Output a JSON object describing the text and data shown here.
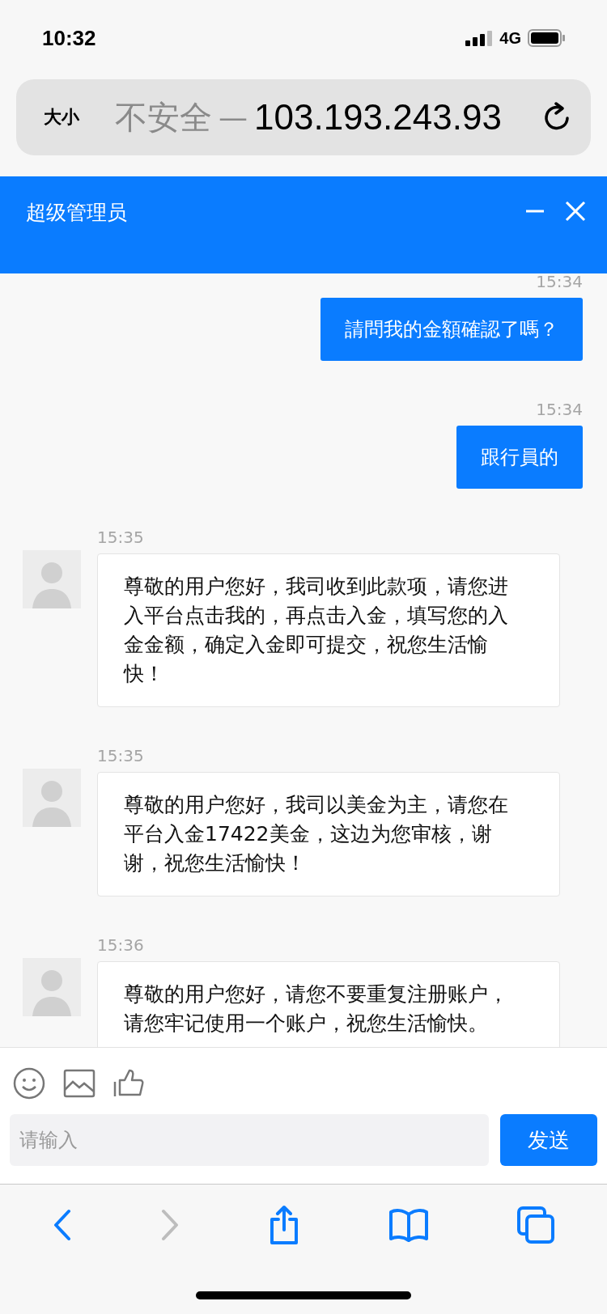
{
  "status_bar": {
    "time": "10:32",
    "network": "4G"
  },
  "address_bar": {
    "text_size": "大小",
    "security": "不安全",
    "separator": "—",
    "url": "103.193.243.93"
  },
  "chat_header": {
    "title": "超级管理员"
  },
  "messages": [
    {
      "kind": "sent",
      "time": "15:34",
      "text": "請問我的金額確認了嗎？"
    },
    {
      "kind": "sent",
      "time": "15:34",
      "text": "跟行員的"
    },
    {
      "kind": "received",
      "time": "15:35",
      "text": "尊敬的用户您好，我司收到此款项，请您进入平台点击我的，再点击入金，填写您的入金金额，确定入金即可提交，祝您生活愉快！"
    },
    {
      "kind": "received",
      "time": "15:35",
      "text": "尊敬的用户您好，我司以美金为主，请您在平台入金17422美金，这边为您审核，谢谢，祝您生活愉快！"
    },
    {
      "kind": "received",
      "time": "15:36",
      "text": "尊敬的用户您好，请您不要重复注册账户，请您牢记使用一个账户，祝您生活愉快。"
    }
  ],
  "composer": {
    "placeholder": "请输入",
    "send_label": "发送"
  }
}
